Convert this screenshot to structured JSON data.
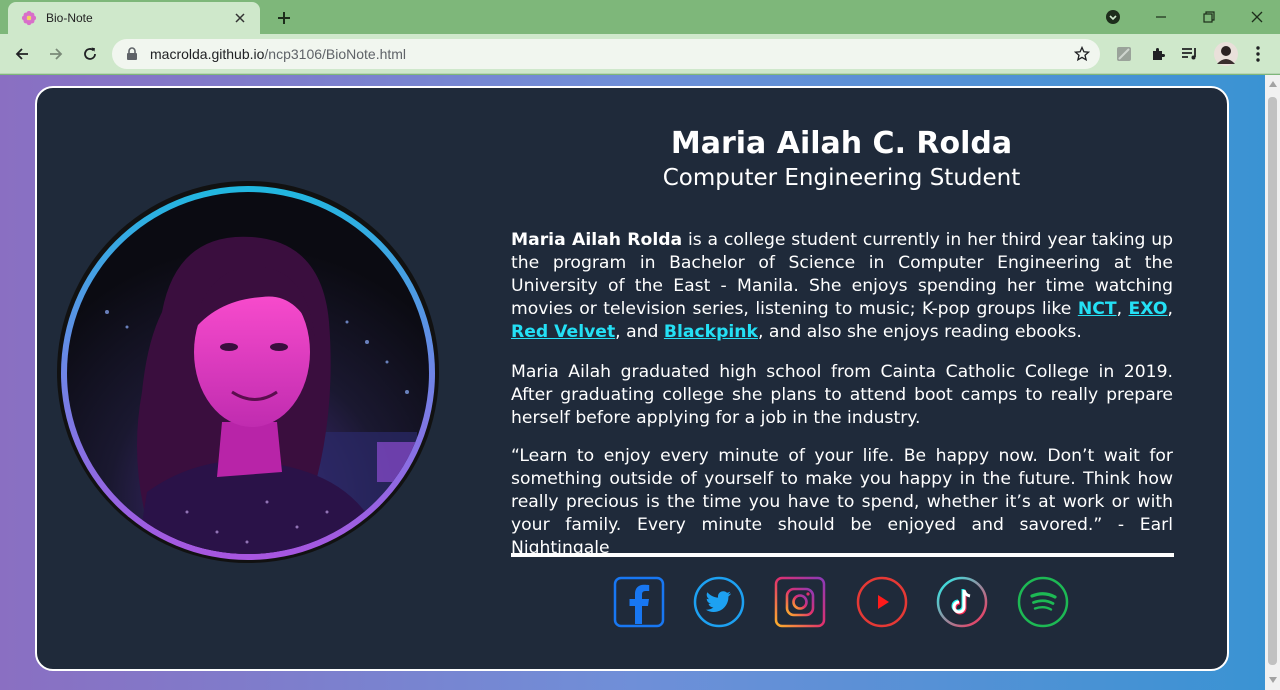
{
  "browser": {
    "tab_title": "Bio-Note",
    "url_host": "macrolda.github.io",
    "url_path": "/ncp3106/BioNote.html"
  },
  "profile": {
    "name": "Maria Ailah C. Rolda",
    "title": "Computer Engineering Student"
  },
  "bio": {
    "p1_bold": "Maria Ailah Rolda",
    "p1_text_a": " is a college student currently in her third year taking up the program in Bachelor of Science in Computer Engineering at the University of the East - Manila. She enjoys spending her time watching movies or television series, listening to music; K-pop groups like ",
    "link_nct": "NCT",
    "sep1": ", ",
    "link_exo": "EXO",
    "sep2": ", ",
    "link_redvelvet": "Red Velvet",
    "sep3": ", and ",
    "link_blackpink": "Blackpink",
    "p1_text_b": ", and also she enjoys reading ebooks.",
    "p2": "Maria Ailah graduated high school from Cainta Catholic College in 2019. After graduating college she plans to attend boot camps to really prepare herself before applying for a job in the industry.",
    "p3": "“Learn to enjoy every minute of your life. Be happy now. Don’t wait for something outside of yourself to make you happy in the future. Think how really precious is the time you have to spend, whether it’s at work or with your family. Every minute should be enjoyed and savored.” - Earl Nightingale"
  },
  "socials": [
    {
      "icon": "facebook-icon",
      "color": "#1877f2"
    },
    {
      "icon": "twitter-icon",
      "color": "#1da1f2"
    },
    {
      "icon": "instagram-icon",
      "color": "#e1306c"
    },
    {
      "icon": "youtube-icon",
      "color": "#ff0000"
    },
    {
      "icon": "tiktok-icon",
      "color": "#25f4ee"
    },
    {
      "icon": "spotify-icon",
      "color": "#1db954"
    }
  ],
  "colors": {
    "card_bg": "#1f2a3a",
    "link": "#24e0f5",
    "chrome_frame": "#7eb77a",
    "chrome_toolbar": "#cfe8cb"
  }
}
